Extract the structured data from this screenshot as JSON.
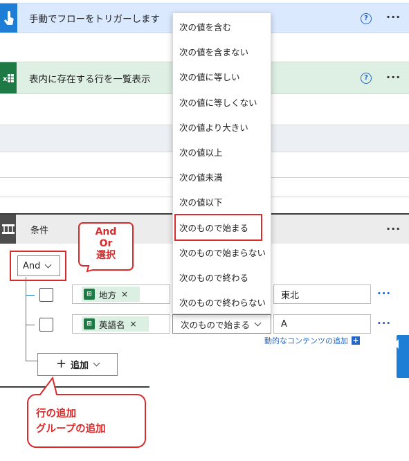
{
  "trigger_card": {
    "title": "手動でフローをトリガーします",
    "help": "?",
    "more": "···",
    "icon": "touch-hand-icon"
  },
  "excel_card": {
    "title": "表内に存在する行を一覧表示",
    "help": "?",
    "more": "···",
    "icon": "excel-icon"
  },
  "condition_card": {
    "title": "条件",
    "more": "···",
    "icon": "condition-branch-icon"
  },
  "operator_dropdown": {
    "options": [
      "次の値を含む",
      "次の値を含まない",
      "次の値に等しい",
      "次の値に等しくない",
      "次の値より大きい",
      "次の値以上",
      "次の値未満",
      "次の値以下",
      "次のもので始まる",
      "次のもので始まらない",
      "次のもので終わる",
      "次のもので終わらない"
    ],
    "highlighted": "次のもので始まる"
  },
  "group_operator": {
    "value": "And"
  },
  "rows": [
    {
      "token_label": "地方",
      "token_remove": "×",
      "operator": "",
      "value": "東北",
      "more": "···"
    },
    {
      "token_label": "英語名",
      "token_remove": "×",
      "operator": "次のもので始まる",
      "value": "A",
      "more": "···"
    }
  ],
  "dynamic_content": {
    "label": "動的なコンテンツの追加",
    "plus": "+"
  },
  "add_button": {
    "plus": "+",
    "label": "追加"
  },
  "annotations": {
    "and_or": [
      "And",
      "Or",
      "選択"
    ],
    "add_row": [
      "行の追加",
      "グループの追加"
    ]
  },
  "colors": {
    "accent": "#1e7ed6",
    "excel": "#1d7a45",
    "callout": "#d92b2b"
  }
}
